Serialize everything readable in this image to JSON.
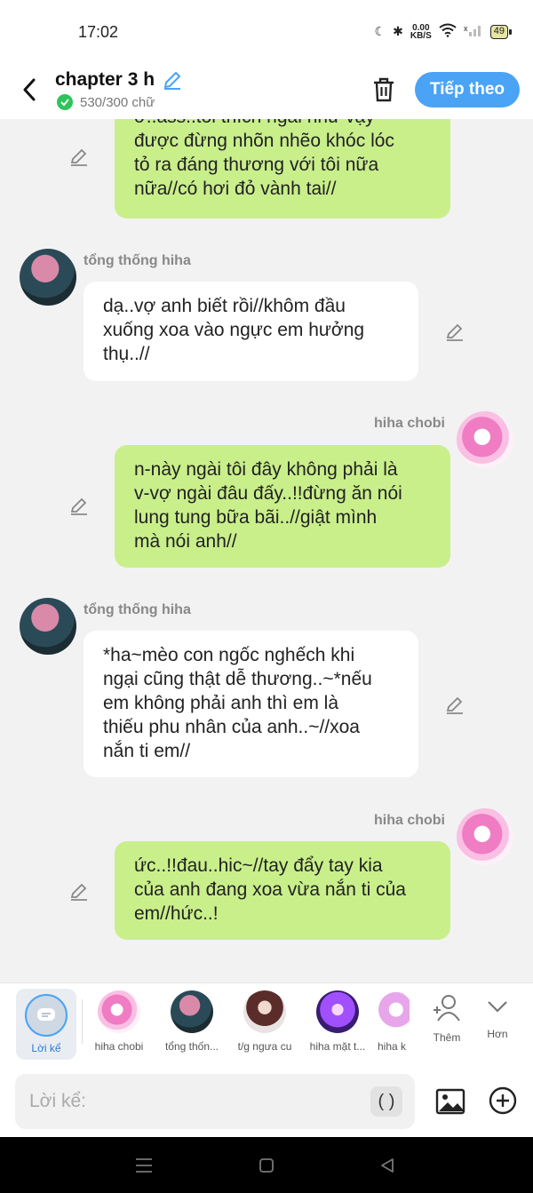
{
  "status_bar": {
    "time": "17:02",
    "net_speed_top": "0.00",
    "net_speed_bottom": "KB/S",
    "battery": "49"
  },
  "header": {
    "title": "chapter 3 h",
    "word_count": "530/300 chữ",
    "next_label": "Tiếp theo",
    "accent_color": "#4aa3f5"
  },
  "messages": [
    {
      "side": "me",
      "text": "ơ..ass..tôi thích ngài như vậy\nđược đừng nhõn nhẽo khóc lóc\ntỏ ra đáng thương với tôi nữa\nnữa//có hơi đỏ vành tai//"
    },
    {
      "side": "other",
      "sender": "tổng thống hiha",
      "text": "dạ..vợ anh biết rồi//khôm đầu\nxuống xoa vào ngực em hưởng\nthụ..//"
    },
    {
      "side": "me",
      "sender": "hiha chobi",
      "text": "n-này ngài tôi đây không phải là\nv-vợ ngài đâu đấy..!!đừng ăn nói\nlung tung bữa bãi..//giật mình\nmà nói anh//"
    },
    {
      "side": "other",
      "sender": "tổng thống hiha",
      "text": "*ha~mèo con ngốc nghếch khi\nngại cũng thật dễ thương..~*nếu\nem không phải anh thì em là\nthiếu phu nhân của anh..~//xoa\nnắn ti em//"
    },
    {
      "side": "me",
      "sender": "hiha chobi",
      "text": "ức..!!đau..hic~//tay đẩy tay kia\ncủa anh đang xoa vừa nắn ti của\nem//hức..!"
    }
  ],
  "characters": {
    "narrator": "Lời kể",
    "list": [
      "hiha chobi",
      "tổng thốn...",
      "t/g ngưa cu",
      "hiha mặt t...",
      "hiha k"
    ],
    "more_label": "Thêm",
    "expand_label": "Hơn"
  },
  "input": {
    "placeholder": "Lời kể:",
    "paren": "( )"
  }
}
